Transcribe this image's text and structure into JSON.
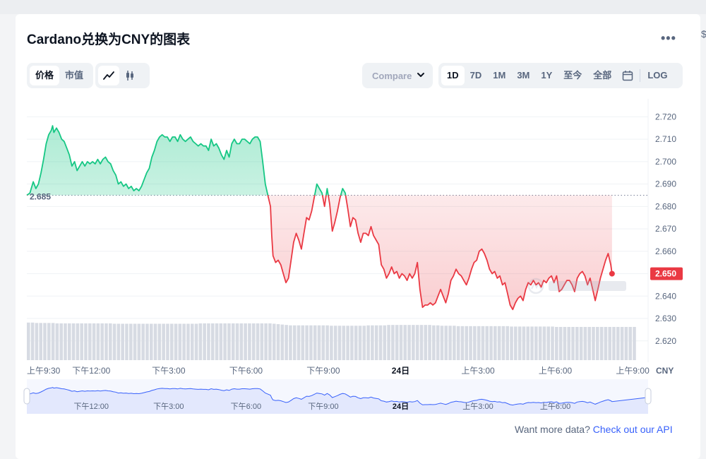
{
  "page": {
    "title": "Cardano兑换为CNY的图表",
    "edge_char": "$"
  },
  "toolbar": {
    "metric_tabs": [
      {
        "label": "价格",
        "active": true
      },
      {
        "label": "市值",
        "active": false
      }
    ],
    "chart_style": {
      "line_icon": "line-chart-icon",
      "candle_icon": "candlestick-icon",
      "active": "line"
    },
    "compare_label": "Compare",
    "ranges": [
      {
        "label": "1D",
        "active": true
      },
      {
        "label": "7D",
        "active": false
      },
      {
        "label": "1M",
        "active": false
      },
      {
        "label": "3M",
        "active": false
      },
      {
        "label": "1Y",
        "active": false
      },
      {
        "label": "至今",
        "active": false
      },
      {
        "label": "全部",
        "active": false
      }
    ],
    "calendar_icon": "calendar-icon",
    "log_label": "LOG",
    "more_icon": "more-icon"
  },
  "footer": {
    "prefix": "Want more data? ",
    "link": "Check out our API"
  },
  "colors": {
    "up": "#16c784",
    "down": "#ea3943",
    "grid": "#eff2f5",
    "nav_fill": "#e3e8fd",
    "nav_line": "#3861fb"
  },
  "chart_data": {
    "type": "line",
    "currency_label": "CNY",
    "reference_label": "2.685",
    "reference_value": 2.685,
    "last_value_label": "2.650",
    "ylim": [
      2.613,
      2.728
    ],
    "y_ticks": [
      {
        "v": 2.72,
        "label": "2.720"
      },
      {
        "v": 2.71,
        "label": "2.710"
      },
      {
        "v": 2.7,
        "label": "2.700"
      },
      {
        "v": 2.69,
        "label": "2.690"
      },
      {
        "v": 2.68,
        "label": "2.680"
      },
      {
        "v": 2.67,
        "label": "2.670"
      },
      {
        "v": 2.66,
        "label": "2.660"
      },
      {
        "v": 2.65,
        "label": "2.650"
      },
      {
        "v": 2.64,
        "label": "2.640"
      },
      {
        "v": 2.63,
        "label": "2.630"
      },
      {
        "v": 2.62,
        "label": "2.620"
      }
    ],
    "xlim": [
      9.5,
      33.6
    ],
    "x_ticks": [
      {
        "t": 9.5,
        "label": "上午9:30"
      },
      {
        "t": 12,
        "label": "下午12:00"
      },
      {
        "t": 15,
        "label": "下午3:00"
      },
      {
        "t": 18,
        "label": "下午6:00"
      },
      {
        "t": 21,
        "label": "下午9:00"
      },
      {
        "t": 24,
        "label": "24日"
      },
      {
        "t": 27,
        "label": "上午3:00"
      },
      {
        "t": 30,
        "label": "上午6:00"
      },
      {
        "t": 33,
        "label": "上午9:00"
      }
    ],
    "nav_ticks": [
      {
        "t": 12,
        "label": "下午12:00"
      },
      {
        "t": 15,
        "label": "下午3:00"
      },
      {
        "t": 18,
        "label": "下午6:00"
      },
      {
        "t": 21,
        "label": "下午9:00"
      },
      {
        "t": 24,
        "label": "24日"
      },
      {
        "t": 27,
        "label": "上午3:00"
      },
      {
        "t": 30,
        "label": "上午6:00"
      }
    ],
    "points": [
      [
        9.5,
        2.685
      ],
      [
        9.62,
        2.686
      ],
      [
        9.75,
        2.691
      ],
      [
        9.85,
        2.688
      ],
      [
        9.95,
        2.69
      ],
      [
        10.05,
        2.695
      ],
      [
        10.15,
        2.701
      ],
      [
        10.25,
        2.708
      ],
      [
        10.35,
        2.712
      ],
      [
        10.45,
        2.714
      ],
      [
        10.5,
        2.716
      ],
      [
        10.55,
        2.713
      ],
      [
        10.65,
        2.715
      ],
      [
        10.75,
        2.713
      ],
      [
        10.85,
        2.71
      ],
      [
        10.95,
        2.709
      ],
      [
        11.05,
        2.706
      ],
      [
        11.15,
        2.703
      ],
      [
        11.25,
        2.698
      ],
      [
        11.35,
        2.7
      ],
      [
        11.45,
        2.696
      ],
      [
        11.55,
        2.698
      ],
      [
        11.65,
        2.7
      ],
      [
        11.75,
        2.698
      ],
      [
        11.85,
        2.7
      ],
      [
        11.95,
        2.699
      ],
      [
        12.05,
        2.7
      ],
      [
        12.15,
        2.699
      ],
      [
        12.25,
        2.701
      ],
      [
        12.35,
        2.699
      ],
      [
        12.45,
        2.701
      ],
      [
        12.55,
        2.702
      ],
      [
        12.65,
        2.7
      ],
      [
        12.75,
        2.699
      ],
      [
        12.85,
        2.696
      ],
      [
        12.95,
        2.694
      ],
      [
        13.05,
        2.69
      ],
      [
        13.15,
        2.691
      ],
      [
        13.25,
        2.689
      ],
      [
        13.35,
        2.69
      ],
      [
        13.45,
        2.688
      ],
      [
        13.55,
        2.689
      ],
      [
        13.65,
        2.687
      ],
      [
        13.75,
        2.688
      ],
      [
        13.85,
        2.687
      ],
      [
        13.95,
        2.689
      ],
      [
        14.05,
        2.692
      ],
      [
        14.15,
        2.695
      ],
      [
        14.25,
        2.697
      ],
      [
        14.35,
        2.702
      ],
      [
        14.45,
        2.705
      ],
      [
        14.55,
        2.709
      ],
      [
        14.65,
        2.711
      ],
      [
        14.75,
        2.712
      ],
      [
        14.85,
        2.711
      ],
      [
        14.95,
        2.711
      ],
      [
        15.05,
        2.709
      ],
      [
        15.15,
        2.711
      ],
      [
        15.25,
        2.711
      ],
      [
        15.35,
        2.709
      ],
      [
        15.45,
        2.712
      ],
      [
        15.55,
        2.71
      ],
      [
        15.65,
        2.709
      ],
      [
        15.75,
        2.71
      ],
      [
        15.85,
        2.711
      ],
      [
        15.95,
        2.709
      ],
      [
        16.05,
        2.708
      ],
      [
        16.15,
        2.707
      ],
      [
        16.25,
        2.708
      ],
      [
        16.35,
        2.707
      ],
      [
        16.45,
        2.707
      ],
      [
        16.55,
        2.705
      ],
      [
        16.65,
        2.71
      ],
      [
        16.75,
        2.707
      ],
      [
        16.85,
        2.708
      ],
      [
        16.95,
        2.706
      ],
      [
        17.05,
        2.703
      ],
      [
        17.15,
        2.701
      ],
      [
        17.25,
        2.705
      ],
      [
        17.35,
        2.702
      ],
      [
        17.45,
        2.708
      ],
      [
        17.55,
        2.71
      ],
      [
        17.65,
        2.708
      ],
      [
        17.75,
        2.708
      ],
      [
        17.85,
        2.71
      ],
      [
        17.95,
        2.71
      ],
      [
        18.05,
        2.709
      ],
      [
        18.15,
        2.708
      ],
      [
        18.25,
        2.71
      ],
      [
        18.35,
        2.711
      ],
      [
        18.45,
        2.711
      ],
      [
        18.55,
        2.709
      ],
      [
        18.65,
        2.7
      ],
      [
        18.75,
        2.69
      ],
      [
        18.85,
        2.685
      ],
      [
        18.95,
        2.68
      ],
      [
        19.0,
        2.667
      ],
      [
        19.05,
        2.658
      ],
      [
        19.15,
        2.655
      ],
      [
        19.25,
        2.656
      ],
      [
        19.35,
        2.654
      ],
      [
        19.45,
        2.65
      ],
      [
        19.55,
        2.646
      ],
      [
        19.65,
        2.648
      ],
      [
        19.75,
        2.656
      ],
      [
        19.85,
        2.664
      ],
      [
        19.95,
        2.668
      ],
      [
        20.05,
        2.665
      ],
      [
        20.15,
        2.661
      ],
      [
        20.25,
        2.668
      ],
      [
        20.35,
        2.675
      ],
      [
        20.45,
        2.674
      ],
      [
        20.55,
        2.678
      ],
      [
        20.65,
        2.684
      ],
      [
        20.75,
        2.69
      ],
      [
        20.85,
        2.688
      ],
      [
        20.95,
        2.686
      ],
      [
        21.05,
        2.68
      ],
      [
        21.15,
        2.688
      ],
      [
        21.25,
        2.681
      ],
      [
        21.35,
        2.669
      ],
      [
        21.45,
        2.673
      ],
      [
        21.55,
        2.678
      ],
      [
        21.65,
        2.684
      ],
      [
        21.75,
        2.688
      ],
      [
        21.85,
        2.686
      ],
      [
        21.95,
        2.679
      ],
      [
        22.05,
        2.671
      ],
      [
        22.15,
        2.675
      ],
      [
        22.25,
        2.674
      ],
      [
        22.35,
        2.668
      ],
      [
        22.45,
        2.664
      ],
      [
        22.55,
        2.668
      ],
      [
        22.65,
        2.668
      ],
      [
        22.75,
        2.667
      ],
      [
        22.85,
        2.671
      ],
      [
        22.95,
        2.667
      ],
      [
        23.05,
        2.665
      ],
      [
        23.15,
        2.663
      ],
      [
        23.25,
        2.654
      ],
      [
        23.35,
        2.652
      ],
      [
        23.45,
        2.648
      ],
      [
        23.55,
        2.65
      ],
      [
        23.65,
        2.653
      ],
      [
        23.75,
        2.65
      ],
      [
        23.85,
        2.651
      ],
      [
        23.95,
        2.648
      ],
      [
        24.05,
        2.65
      ],
      [
        24.15,
        2.649
      ],
      [
        24.25,
        2.647
      ],
      [
        24.35,
        2.65
      ],
      [
        24.45,
        2.648
      ],
      [
        24.55,
        2.65
      ],
      [
        24.65,
        2.655
      ],
      [
        24.75,
        2.643
      ],
      [
        24.85,
        2.635
      ],
      [
        24.95,
        2.636
      ],
      [
        25.05,
        2.636
      ],
      [
        25.15,
        2.637
      ],
      [
        25.25,
        2.636
      ],
      [
        25.35,
        2.637
      ],
      [
        25.45,
        2.64
      ],
      [
        25.55,
        2.643
      ],
      [
        25.65,
        2.64
      ],
      [
        25.75,
        2.637
      ],
      [
        25.85,
        2.641
      ],
      [
        25.95,
        2.647
      ],
      [
        26.05,
        2.649
      ],
      [
        26.15,
        2.652
      ],
      [
        26.25,
        2.65
      ],
      [
        26.35,
        2.649
      ],
      [
        26.45,
        2.647
      ],
      [
        26.55,
        2.645
      ],
      [
        26.65,
        2.648
      ],
      [
        26.75,
        2.652
      ],
      [
        26.85,
        2.655
      ],
      [
        26.95,
        2.656
      ],
      [
        27.05,
        2.66
      ],
      [
        27.15,
        2.661
      ],
      [
        27.25,
        2.659
      ],
      [
        27.35,
        2.656
      ],
      [
        27.45,
        2.652
      ],
      [
        27.55,
        2.65
      ],
      [
        27.65,
        2.651
      ],
      [
        27.75,
        2.648
      ],
      [
        27.85,
        2.649
      ],
      [
        27.95,
        2.645
      ],
      [
        28.05,
        2.646
      ],
      [
        28.15,
        2.641
      ],
      [
        28.25,
        2.636
      ],
      [
        28.35,
        2.634
      ],
      [
        28.45,
        2.637
      ],
      [
        28.55,
        2.639
      ],
      [
        28.65,
        2.64
      ],
      [
        28.75,
        2.638
      ],
      [
        28.85,
        2.643
      ],
      [
        28.95,
        2.646
      ],
      [
        29.05,
        2.645
      ],
      [
        29.15,
        2.647
      ],
      [
        29.25,
        2.645
      ],
      [
        29.35,
        2.646
      ],
      [
        29.45,
        2.644
      ],
      [
        29.55,
        2.647
      ],
      [
        29.65,
        2.646
      ],
      [
        29.75,
        2.648
      ],
      [
        29.85,
        2.649
      ],
      [
        29.95,
        2.646
      ],
      [
        30.05,
        2.649
      ],
      [
        30.15,
        2.642
      ],
      [
        30.25,
        2.643
      ],
      [
        30.35,
        2.645
      ],
      [
        30.45,
        2.647
      ],
      [
        30.55,
        2.647
      ],
      [
        30.65,
        2.645
      ],
      [
        30.75,
        2.642
      ],
      [
        30.85,
        2.648
      ],
      [
        30.95,
        2.65
      ],
      [
        31.05,
        2.651
      ],
      [
        31.15,
        2.649
      ],
      [
        31.25,
        2.645
      ],
      [
        31.35,
        2.648
      ],
      [
        31.45,
        2.643
      ],
      [
        31.55,
        2.638
      ],
      [
        31.65,
        2.643
      ],
      [
        31.75,
        2.648
      ],
      [
        31.85,
        2.652
      ],
      [
        31.95,
        2.656
      ],
      [
        32.05,
        2.659
      ],
      [
        32.15,
        2.654
      ],
      [
        32.2,
        2.65
      ]
    ],
    "volume_relative": [
      0.95,
      0.95,
      0.94,
      0.94,
      0.94,
      0.94,
      0.94,
      0.93,
      0.93,
      0.93,
      0.93,
      0.93,
      0.93,
      0.93,
      0.93,
      0.93,
      0.93,
      0.93,
      0.93,
      0.93,
      0.93,
      0.92,
      0.92,
      0.92,
      0.92,
      0.92,
      0.92,
      0.92,
      0.92,
      0.92,
      0.92,
      0.92,
      0.92,
      0.92,
      0.92,
      0.92,
      0.92,
      0.92,
      0.92,
      0.92,
      0.92,
      0.92,
      0.93,
      0.93,
      0.93,
      0.93,
      0.93,
      0.93,
      0.93,
      0.93,
      0.93,
      0.93,
      0.93,
      0.93,
      0.93,
      0.93,
      0.93,
      0.93,
      0.93,
      0.93,
      0.92,
      0.91,
      0.9,
      0.89,
      0.88,
      0.88,
      0.88,
      0.88,
      0.88,
      0.88,
      0.88,
      0.88,
      0.88,
      0.88,
      0.87,
      0.87,
      0.87,
      0.87,
      0.87,
      0.87,
      0.87,
      0.87,
      0.87,
      0.88,
      0.88,
      0.88,
      0.88,
      0.88,
      0.89,
      0.89,
      0.89,
      0.89,
      0.89,
      0.89,
      0.89,
      0.89,
      0.89,
      0.89,
      0.89,
      0.88,
      0.88,
      0.87,
      0.87,
      0.87,
      0.87,
      0.86,
      0.86,
      0.86,
      0.86,
      0.86,
      0.86,
      0.86,
      0.86,
      0.86,
      0.86,
      0.86,
      0.86,
      0.86,
      0.85,
      0.85,
      0.85,
      0.85,
      0.85,
      0.85,
      0.85,
      0.85,
      0.85,
      0.85,
      0.85,
      0.84,
      0.84,
      0.84,
      0.84,
      0.84,
      0.84,
      0.84,
      0.84,
      0.84,
      0.84,
      0.84,
      0.84,
      0.84,
      0.84,
      0.84,
      0.84,
      0.84,
      0.84,
      0.84,
      0.84
    ]
  }
}
